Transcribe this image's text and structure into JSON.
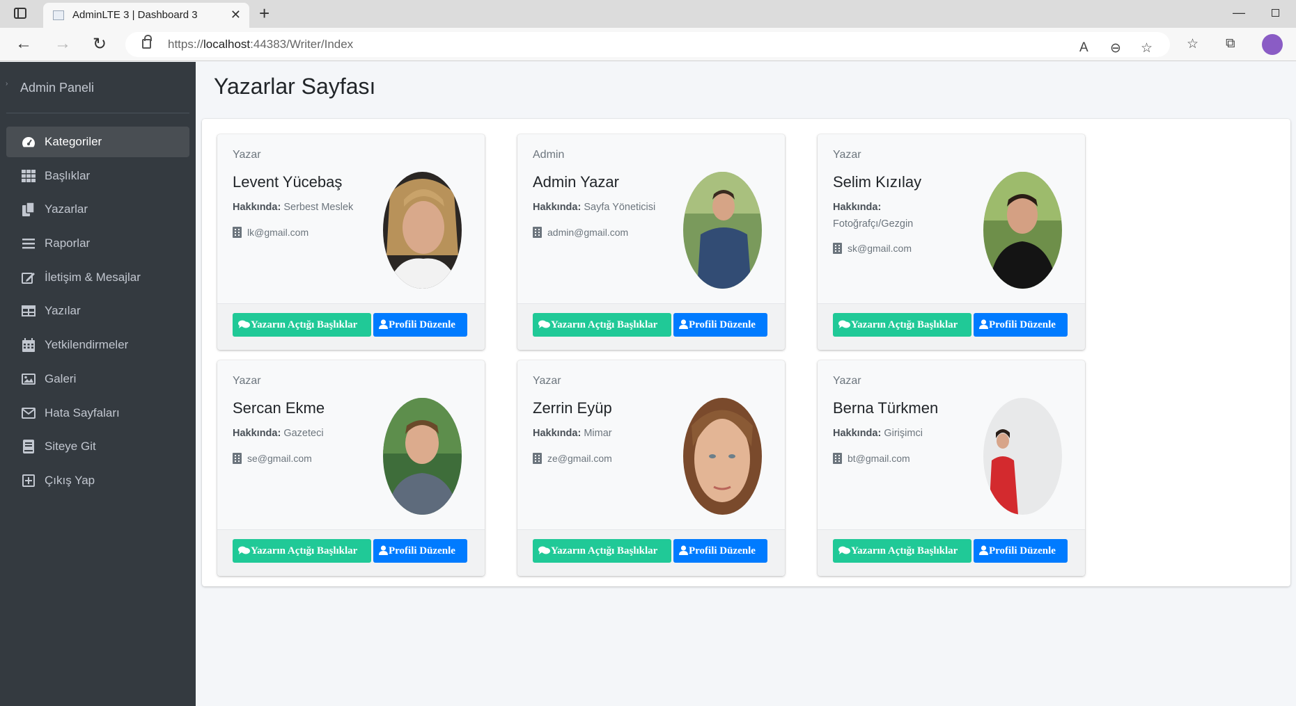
{
  "browser": {
    "tab_title": "AdminLTE 3 | Dashboard 3",
    "url_prefix": "https://",
    "url_host": "localhost",
    "url_rest": ":44383/Writer/Index"
  },
  "sidebar": {
    "brand": "Admin Paneli",
    "items": [
      {
        "label": "Kategoriler",
        "icon": "tachometer-icon",
        "active": true
      },
      {
        "label": "Başlıklar",
        "icon": "grid-icon"
      },
      {
        "label": "Yazarlar",
        "icon": "copy-icon"
      },
      {
        "label": "Raporlar",
        "icon": "bars-icon"
      },
      {
        "label": "İletişim & Mesajlar",
        "icon": "edit-icon"
      },
      {
        "label": "Yazılar",
        "icon": "table-icon"
      },
      {
        "label": "Yetkilendirmeler",
        "icon": "calendar-icon"
      },
      {
        "label": "Galeri",
        "icon": "image-icon"
      },
      {
        "label": "Hata Sayfaları",
        "icon": "envelope-icon"
      },
      {
        "label": "Siteye Git",
        "icon": "book-icon"
      },
      {
        "label": "Çıkış Yap",
        "icon": "plus-square-icon"
      }
    ]
  },
  "page": {
    "title": "Yazarlar Sayfası"
  },
  "writers": [
    {
      "role": "Yazar",
      "name": "Levent Yücebaş",
      "about_label": "Hakkında:",
      "about": "Serbest Meslek",
      "email": "lk@gmail.com",
      "button_titles": "Yazarın Açtığı Başlıklar",
      "button_edit": "Profili Düzenle"
    },
    {
      "role": "Admin",
      "name": "Admin Yazar",
      "about_label": "Hakkında:",
      "about": "Sayfa Yöneticisi",
      "email": "admin@gmail.com",
      "button_titles": "Yazarın Açtığı Başlıklar",
      "button_edit": "Profili Düzenle"
    },
    {
      "role": "Yazar",
      "name": "Selim Kızılay",
      "about_label": "Hakkında:",
      "about": "Fotoğrafçı/Gezgin",
      "email": "sk@gmail.com",
      "button_titles": "Yazarın Açtığı Başlıklar",
      "button_edit": "Profili Düzenle"
    },
    {
      "role": "Yazar",
      "name": "Sercan Ekme",
      "about_label": "Hakkında:",
      "about": "Gazeteci",
      "email": "se@gmail.com",
      "button_titles": "Yazarın Açtığı Başlıklar",
      "button_edit": "Profili Düzenle"
    },
    {
      "role": "Yazar",
      "name": "Zerrin Eyüp",
      "about_label": "Hakkında:",
      "about": "Mimar",
      "email": "ze@gmail.com",
      "button_titles": "Yazarın Açtığı Başlıklar",
      "button_edit": "Profili Düzenle"
    },
    {
      "role": "Yazar",
      "name": "Berna Türkmen",
      "about_label": "Hakkında:",
      "about": "Girişimci",
      "email": "bt@gmail.com",
      "button_titles": "Yazarın Açtığı Başlıklar",
      "button_edit": "Profili Düzenle"
    }
  ],
  "colors": {
    "sidebar_bg": "#343a40",
    "btn_green": "#20c997",
    "btn_blue": "#007bff",
    "profile_avatar": "#8a5cc5"
  }
}
